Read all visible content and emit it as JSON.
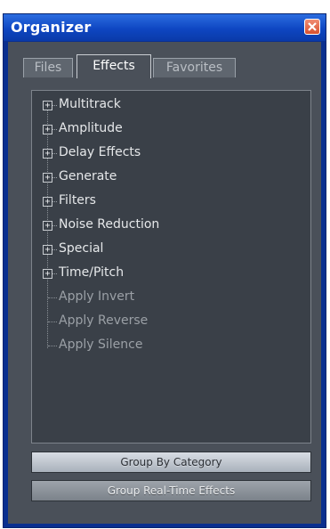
{
  "window": {
    "title": "Organizer"
  },
  "tabs": [
    {
      "label": "Files",
      "active": false
    },
    {
      "label": "Effects",
      "active": true
    },
    {
      "label": "Favorites",
      "active": false
    }
  ],
  "tree": {
    "categories": [
      "Multitrack",
      "Amplitude",
      "Delay Effects",
      "Generate",
      "Filters",
      "Noise Reduction",
      "Special",
      "Time/Pitch"
    ],
    "actions": [
      "Apply Invert",
      "Apply Reverse",
      "Apply Silence"
    ]
  },
  "buttons": {
    "group_by_category": "Group By Category",
    "group_realtime": "Group Real-Time Effects"
  },
  "colors": {
    "title_bar": "#0e46c2",
    "panel_bg": "#4a5059",
    "tree_bg": "#3a4048",
    "close_button": "#d9502d"
  }
}
